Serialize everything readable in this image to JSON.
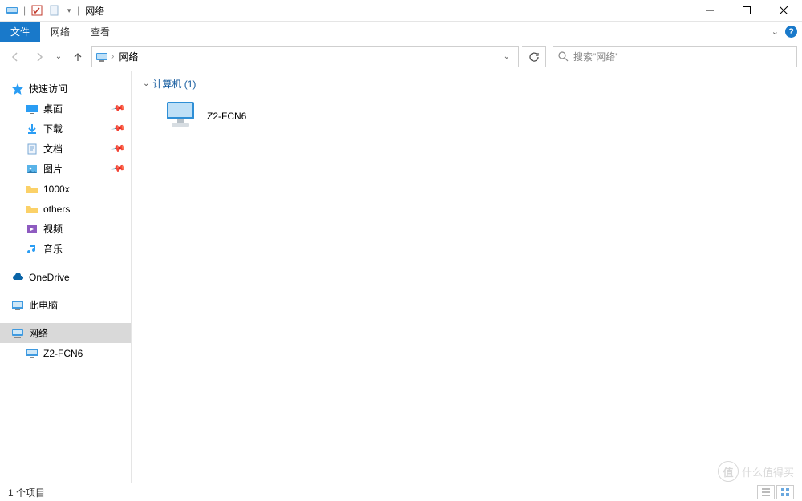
{
  "title": "网络",
  "ribbon": {
    "file": "文件",
    "tabs": [
      "网络",
      "查看"
    ]
  },
  "nav": {
    "back_enabled": false,
    "forward_enabled": false
  },
  "address": {
    "root_icon": "network-icon",
    "crumbs": [
      "网络"
    ]
  },
  "refresh_label": "刷新",
  "search": {
    "placeholder": "搜索\"网络\""
  },
  "sidebar": {
    "quick_access": {
      "label": "快速访问"
    },
    "quick_items": [
      {
        "label": "桌面",
        "icon": "desktop",
        "pinned": true
      },
      {
        "label": "下载",
        "icon": "downloads",
        "pinned": true
      },
      {
        "label": "文档",
        "icon": "documents",
        "pinned": true
      },
      {
        "label": "图片",
        "icon": "pictures",
        "pinned": true
      },
      {
        "label": "1000x",
        "icon": "folder",
        "pinned": false
      },
      {
        "label": "others",
        "icon": "folder",
        "pinned": false
      },
      {
        "label": "视频",
        "icon": "videos",
        "pinned": false
      },
      {
        "label": "音乐",
        "icon": "music",
        "pinned": false
      }
    ],
    "onedrive": {
      "label": "OneDrive"
    },
    "this_pc": {
      "label": "此电脑"
    },
    "network": {
      "label": "网络"
    },
    "network_children": [
      {
        "label": "Z2-FCN6"
      }
    ]
  },
  "content": {
    "group_header": "计算机 (1)",
    "computers": [
      {
        "name": "Z2-FCN6"
      }
    ]
  },
  "statusbar": {
    "item_count": "1 个项目"
  },
  "watermark": "什么值得买"
}
